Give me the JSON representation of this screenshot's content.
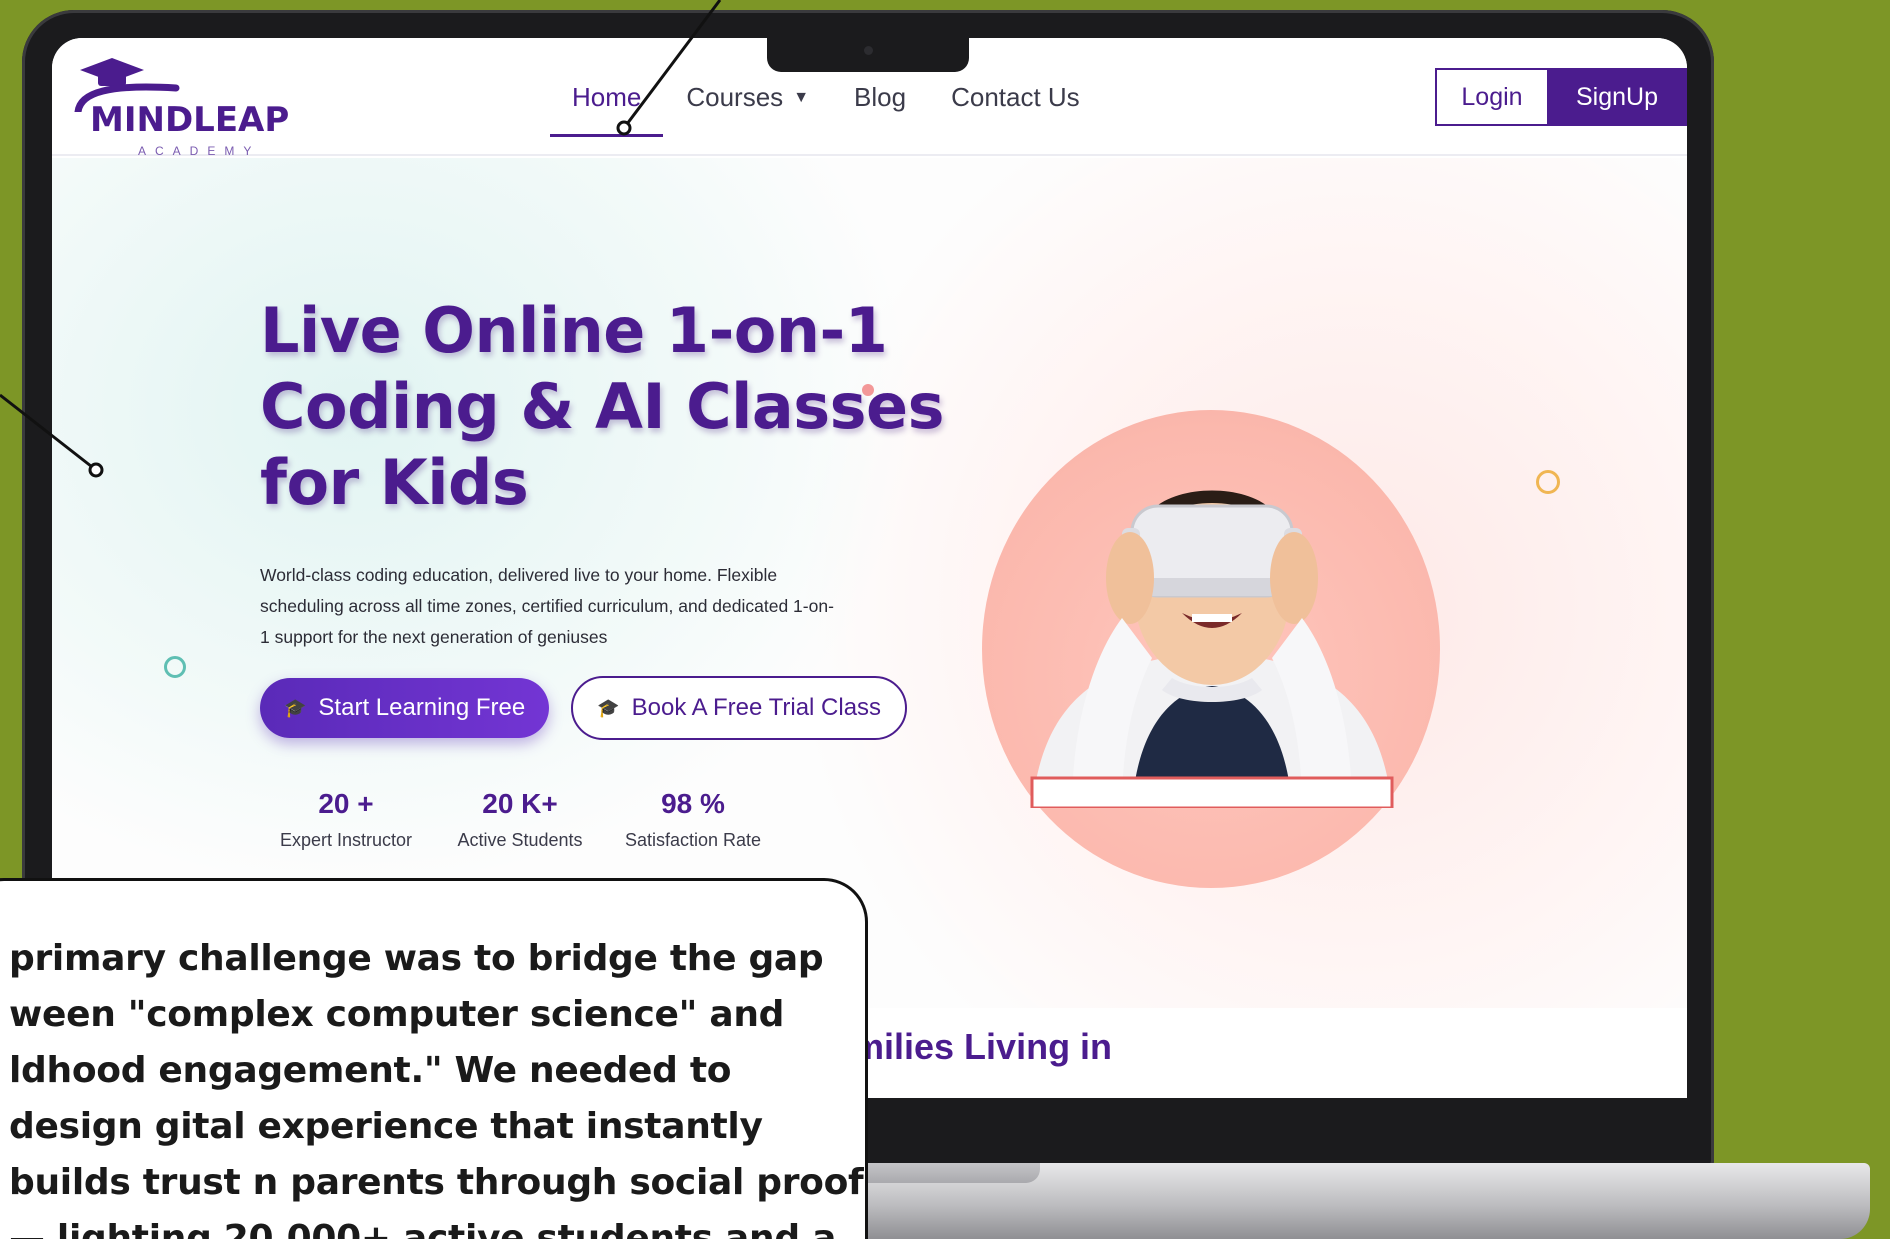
{
  "brand": {
    "name": "MINDLEAP",
    "sub": "ACADEMY"
  },
  "nav": {
    "items": [
      {
        "label": "Home",
        "active": true
      },
      {
        "label": "Courses",
        "has_dropdown": true
      },
      {
        "label": "Blog"
      },
      {
        "label": "Contact Us"
      }
    ],
    "login_label": "Login",
    "signup_label": "SignUp"
  },
  "hero": {
    "title": "Live Online 1-on-1 Coding & AI Classes for Kids",
    "description": "World-class coding education, delivered live to your home. Flexible scheduling across all time zones, certified curriculum, and dedicated 1-on-1 support for the next generation of geniuses",
    "primary_cta": "Start Learning Free",
    "secondary_cta": "Book A Free Trial Class",
    "stats": [
      {
        "value": "20 +",
        "label": "Expert Instructor"
      },
      {
        "value": "20 K+",
        "label": "Active Students"
      },
      {
        "value": "98 %",
        "label": "Satisfaction Rate"
      }
    ]
  },
  "section2": {
    "title_fragment": "milies Living in"
  },
  "callout": {
    "text": "primary challenge was to bridge the gap ween \"complex computer science\" and ldhood engagement.\" We needed to design gital experience that instantly builds trust n parents through social proof — lighting 20,000+ active students and a"
  },
  "colors": {
    "background": "#7d9626",
    "brand_purple": "#4b1c8e",
    "accent_pink": "#fbb8ad"
  },
  "icons": {
    "cap": "graduation-cap-icon",
    "caret": "caret-down-icon"
  }
}
